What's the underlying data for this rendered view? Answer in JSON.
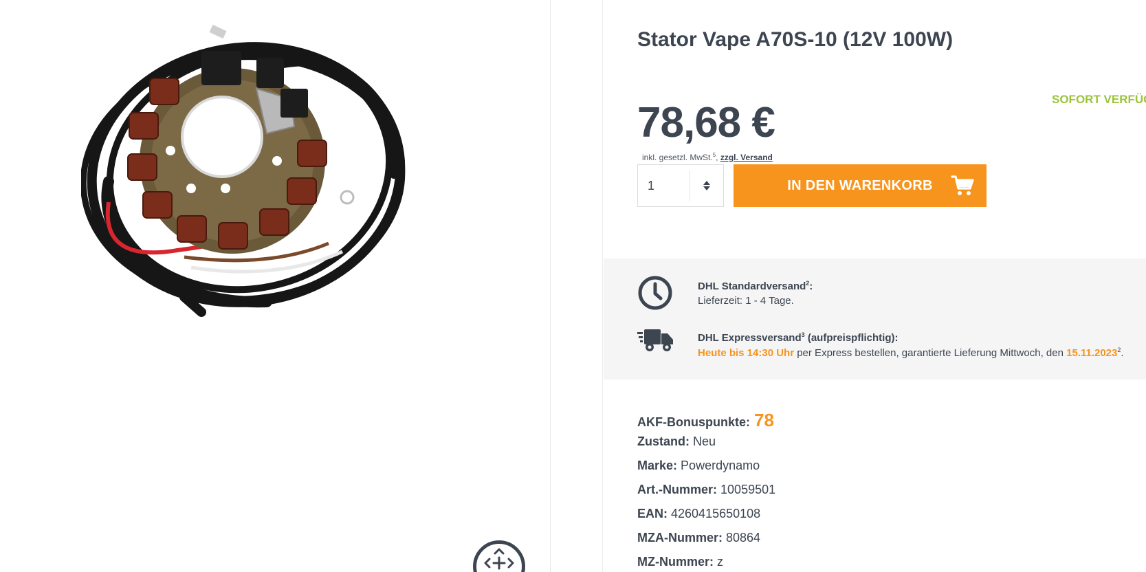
{
  "product": {
    "title": "Stator Vape A70S-10 (12V 100W)",
    "image_alt": "Stator with coils and cable harness"
  },
  "availability": "SOFORT VERFÜG",
  "pricing": {
    "price": "78,68 €",
    "tax_prefix": "inkl. gesetzl. MwSt.",
    "tax_sup": "5",
    "tax_sep": ", ",
    "shipping_link": "zzgl. Versand"
  },
  "cart": {
    "quantity": "1",
    "button_label": "IN DEN WARENKORB"
  },
  "shipping": {
    "standard": {
      "title": "DHL Standardversand",
      "title_sup": "2",
      "title_suffix": ":",
      "text": "Lieferzeit: 1 - 4 Tage."
    },
    "express": {
      "title": "DHL Expressversand",
      "title_sup": "3",
      "title_suffix": " (aufpreispflichtig):",
      "highlight_time": "Heute bis 14:30 Uhr",
      "text_mid": " per Express bestellen, garantierte Lieferung Mittwoch, den ",
      "highlight_date": "15.11.2023",
      "date_sup": "2",
      "text_end": "."
    }
  },
  "specs": {
    "bonus": {
      "label": "AKF-Bonuspunkte:",
      "value": "78"
    },
    "zustand": {
      "label": "Zustand:",
      "value": "Neu"
    },
    "marke": {
      "label": "Marke:",
      "value": "Powerdynamo"
    },
    "art_nummer": {
      "label": "Art.-Nummer:",
      "value": "10059501"
    },
    "ean": {
      "label": "EAN:",
      "value": "4260415650108"
    },
    "mza_nummer": {
      "label": "MZA-Nummer:",
      "value": "80864"
    },
    "mz_nummer": {
      "label": "MZ-Nummer:",
      "value": "z"
    }
  },
  "icons": {
    "clock": "clock-icon",
    "truck": "truck-icon",
    "cart": "cart-icon",
    "zoom": "zoom-move-icon"
  },
  "colors": {
    "accent": "#f7941d",
    "text": "#3d4551",
    "availability": "#9bc43b",
    "shipping_bg": "#f5f5f5"
  }
}
